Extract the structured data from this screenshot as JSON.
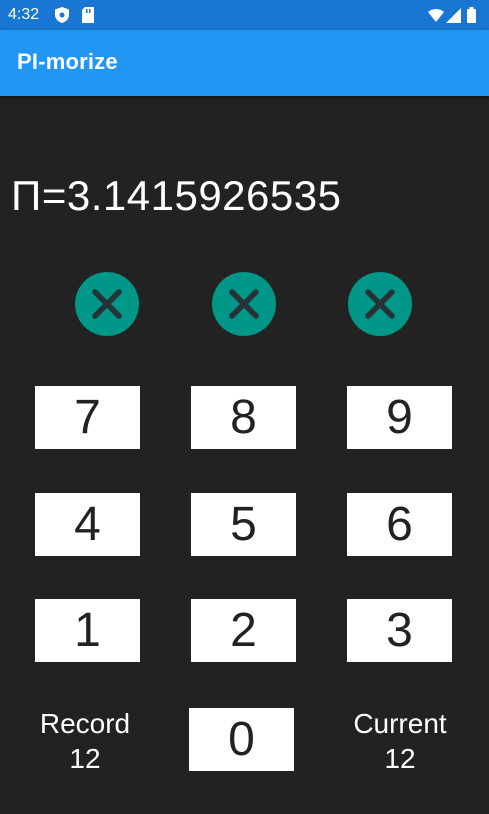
{
  "status_bar": {
    "time": "4:32",
    "icons": [
      "shield-icon",
      "sd-card-icon",
      "wifi-icon",
      "signal-icon",
      "battery-icon"
    ]
  },
  "app_bar": {
    "title": "PI-morize",
    "color": "#2196f3"
  },
  "pi_display": {
    "text": "Π=3.1415926535"
  },
  "mistakes": {
    "count_shown": 3,
    "icon": "close-icon",
    "color": "#009688"
  },
  "keypad": {
    "keys": [
      "7",
      "8",
      "9",
      "4",
      "5",
      "6",
      "1",
      "2",
      "3",
      "0"
    ]
  },
  "stats": {
    "record_label": "Record",
    "record_value": "12",
    "current_label": "Current",
    "current_value": "12"
  }
}
